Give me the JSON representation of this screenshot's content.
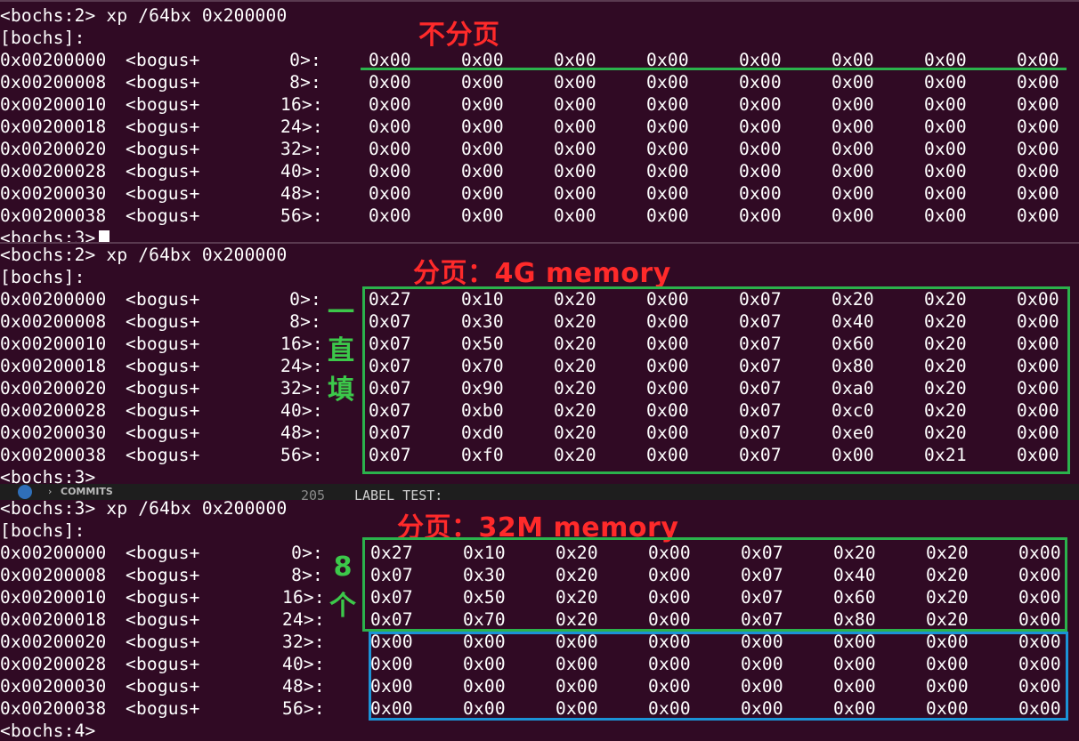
{
  "panel1": {
    "command_line": "<bochs:2> xp /64bx 0x200000",
    "bracket_line": "[bochs]:",
    "prompt_after": "<bochs:3>",
    "annotation": "不分页",
    "rows": [
      {
        "addr": "0x00200000",
        "label": "<bogus+",
        "offset": "0>:",
        "values": [
          "0x00",
          "0x00",
          "0x00",
          "0x00",
          "0x00",
          "0x00",
          "0x00",
          "0x00"
        ]
      },
      {
        "addr": "0x00200008",
        "label": "<bogus+",
        "offset": "8>:",
        "values": [
          "0x00",
          "0x00",
          "0x00",
          "0x00",
          "0x00",
          "0x00",
          "0x00",
          "0x00"
        ]
      },
      {
        "addr": "0x00200010",
        "label": "<bogus+",
        "offset": "16>:",
        "values": [
          "0x00",
          "0x00",
          "0x00",
          "0x00",
          "0x00",
          "0x00",
          "0x00",
          "0x00"
        ]
      },
      {
        "addr": "0x00200018",
        "label": "<bogus+",
        "offset": "24>:",
        "values": [
          "0x00",
          "0x00",
          "0x00",
          "0x00",
          "0x00",
          "0x00",
          "0x00",
          "0x00"
        ]
      },
      {
        "addr": "0x00200020",
        "label": "<bogus+",
        "offset": "32>:",
        "values": [
          "0x00",
          "0x00",
          "0x00",
          "0x00",
          "0x00",
          "0x00",
          "0x00",
          "0x00"
        ]
      },
      {
        "addr": "0x00200028",
        "label": "<bogus+",
        "offset": "40>:",
        "values": [
          "0x00",
          "0x00",
          "0x00",
          "0x00",
          "0x00",
          "0x00",
          "0x00",
          "0x00"
        ]
      },
      {
        "addr": "0x00200030",
        "label": "<bogus+",
        "offset": "48>:",
        "values": [
          "0x00",
          "0x00",
          "0x00",
          "0x00",
          "0x00",
          "0x00",
          "0x00",
          "0x00"
        ]
      },
      {
        "addr": "0x00200038",
        "label": "<bogus+",
        "offset": "56>:",
        "values": [
          "0x00",
          "0x00",
          "0x00",
          "0x00",
          "0x00",
          "0x00",
          "0x00",
          "0x00"
        ]
      }
    ]
  },
  "panel2": {
    "command_line": "<bochs:2> xp /64bx 0x200000",
    "bracket_line": "[bochs]:",
    "prompt_after": "<bochs:3>",
    "annotation": "分页：4G memory",
    "side_annotation": [
      "一",
      "直",
      "填"
    ],
    "rows": [
      {
        "addr": "0x00200000",
        "label": "<bogus+",
        "offset": "0>:",
        "values": [
          "0x27",
          "0x10",
          "0x20",
          "0x00",
          "0x07",
          "0x20",
          "0x20",
          "0x00"
        ]
      },
      {
        "addr": "0x00200008",
        "label": "<bogus+",
        "offset": "8>:",
        "values": [
          "0x07",
          "0x30",
          "0x20",
          "0x00",
          "0x07",
          "0x40",
          "0x20",
          "0x00"
        ]
      },
      {
        "addr": "0x00200010",
        "label": "<bogus+",
        "offset": "16>:",
        "values": [
          "0x07",
          "0x50",
          "0x20",
          "0x00",
          "0x07",
          "0x60",
          "0x20",
          "0x00"
        ]
      },
      {
        "addr": "0x00200018",
        "label": "<bogus+",
        "offset": "24>:",
        "values": [
          "0x07",
          "0x70",
          "0x20",
          "0x00",
          "0x07",
          "0x80",
          "0x20",
          "0x00"
        ]
      },
      {
        "addr": "0x00200020",
        "label": "<bogus+",
        "offset": "32>:",
        "values": [
          "0x07",
          "0x90",
          "0x20",
          "0x00",
          "0x07",
          "0xa0",
          "0x20",
          "0x00"
        ]
      },
      {
        "addr": "0x00200028",
        "label": "<bogus+",
        "offset": "40>:",
        "values": [
          "0x07",
          "0xb0",
          "0x20",
          "0x00",
          "0x07",
          "0xc0",
          "0x20",
          "0x00"
        ]
      },
      {
        "addr": "0x00200030",
        "label": "<bogus+",
        "offset": "48>:",
        "values": [
          "0x07",
          "0xd0",
          "0x20",
          "0x00",
          "0x07",
          "0xe0",
          "0x20",
          "0x00"
        ]
      },
      {
        "addr": "0x00200038",
        "label": "<bogus+",
        "offset": "56>:",
        "values": [
          "0x07",
          "0xf0",
          "0x20",
          "0x00",
          "0x07",
          "0x00",
          "0x21",
          "0x00"
        ]
      }
    ]
  },
  "separator": {
    "commits_label": "COMMITS",
    "chevron": "›",
    "line_number": "205",
    "code": "LABEL_TEST:"
  },
  "panel3": {
    "command_line": "<bochs:3> xp /64bx 0x200000",
    "bracket_line": "[bochs]:",
    "prompt_after": "<bochs:4>",
    "annotation": "分页：32M memory",
    "side_annotation": [
      "8",
      "个"
    ],
    "rows": [
      {
        "addr": "0x00200000",
        "label": "<bogus+",
        "offset": "0>:",
        "values": [
          "0x27",
          "0x10",
          "0x20",
          "0x00",
          "0x07",
          "0x20",
          "0x20",
          "0x00"
        ]
      },
      {
        "addr": "0x00200008",
        "label": "<bogus+",
        "offset": "8>:",
        "values": [
          "0x07",
          "0x30",
          "0x20",
          "0x00",
          "0x07",
          "0x40",
          "0x20",
          "0x00"
        ]
      },
      {
        "addr": "0x00200010",
        "label": "<bogus+",
        "offset": "16>:",
        "values": [
          "0x07",
          "0x50",
          "0x20",
          "0x00",
          "0x07",
          "0x60",
          "0x20",
          "0x00"
        ]
      },
      {
        "addr": "0x00200018",
        "label": "<bogus+",
        "offset": "24>:",
        "values": [
          "0x07",
          "0x70",
          "0x20",
          "0x00",
          "0x07",
          "0x80",
          "0x20",
          "0x00"
        ]
      },
      {
        "addr": "0x00200020",
        "label": "<bogus+",
        "offset": "32>:",
        "values": [
          "0x00",
          "0x00",
          "0x00",
          "0x00",
          "0x00",
          "0x00",
          "0x00",
          "0x00"
        ]
      },
      {
        "addr": "0x00200028",
        "label": "<bogus+",
        "offset": "40>:",
        "values": [
          "0x00",
          "0x00",
          "0x00",
          "0x00",
          "0x00",
          "0x00",
          "0x00",
          "0x00"
        ]
      },
      {
        "addr": "0x00200030",
        "label": "<bogus+",
        "offset": "48>:",
        "values": [
          "0x00",
          "0x00",
          "0x00",
          "0x00",
          "0x00",
          "0x00",
          "0x00",
          "0x00"
        ]
      },
      {
        "addr": "0x00200038",
        "label": "<bogus+",
        "offset": "56>:",
        "values": [
          "0x00",
          "0x00",
          "0x00",
          "0x00",
          "0x00",
          "0x00",
          "0x00",
          "0x00"
        ]
      }
    ]
  },
  "colors": {
    "background": "#300a24",
    "annotation_red": "#ff2a2a",
    "annotation_green": "#3cc84a",
    "box_green": "#2bb24c",
    "box_blue": "#1b93d6"
  }
}
